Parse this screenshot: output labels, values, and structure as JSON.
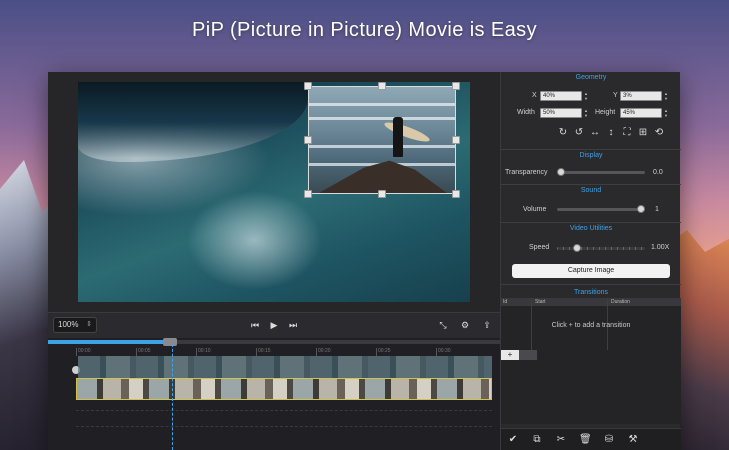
{
  "headline": "PiP (Picture in Picture) Movie is Easy",
  "playback": {
    "zoom": "100%",
    "zoom_arrow": "⌃⌄",
    "icons": [
      "skip-back-icon",
      "play-icon",
      "skip-forward-icon",
      "fullscreen-icon",
      "settings-icon",
      "export-icon"
    ]
  },
  "timeline": {
    "progress_fraction": 0.27,
    "ruler_ticks": [
      "00:00",
      "00:05",
      "00:10",
      "00:15",
      "00:20",
      "00:25",
      "00:30"
    ]
  },
  "panel": {
    "geometry": {
      "title": "Geometry",
      "x_label": "X",
      "x_value": "40%",
      "y_label": "Y",
      "y_value": "3%",
      "width_label": "Width",
      "width_value": "50%",
      "height_label": "Height",
      "height_value": "45%"
    },
    "display": {
      "title": "Display",
      "transparency_label": "Transparency",
      "transparency_value": "0.0",
      "transparency_fraction": 0.0
    },
    "sound": {
      "title": "Sound",
      "volume_label": "Volume",
      "volume_value": "1",
      "volume_fraction": 1.0
    },
    "video_utilities": {
      "title": "Video Utilities",
      "speed_label": "Speed",
      "speed_value": "1.00X",
      "speed_fraction": 0.2,
      "capture_label": "Capture Image"
    },
    "transitions": {
      "title": "Transitions",
      "col_id": "Id",
      "col_start": "Start",
      "col_duration": "Duration",
      "empty_text": "Click + to add a transition",
      "plus_label": "+"
    }
  },
  "colors": {
    "accent": "#3ea2e6",
    "panel_bg": "#2a2a2d",
    "window_bg": "#1c1c1f"
  }
}
